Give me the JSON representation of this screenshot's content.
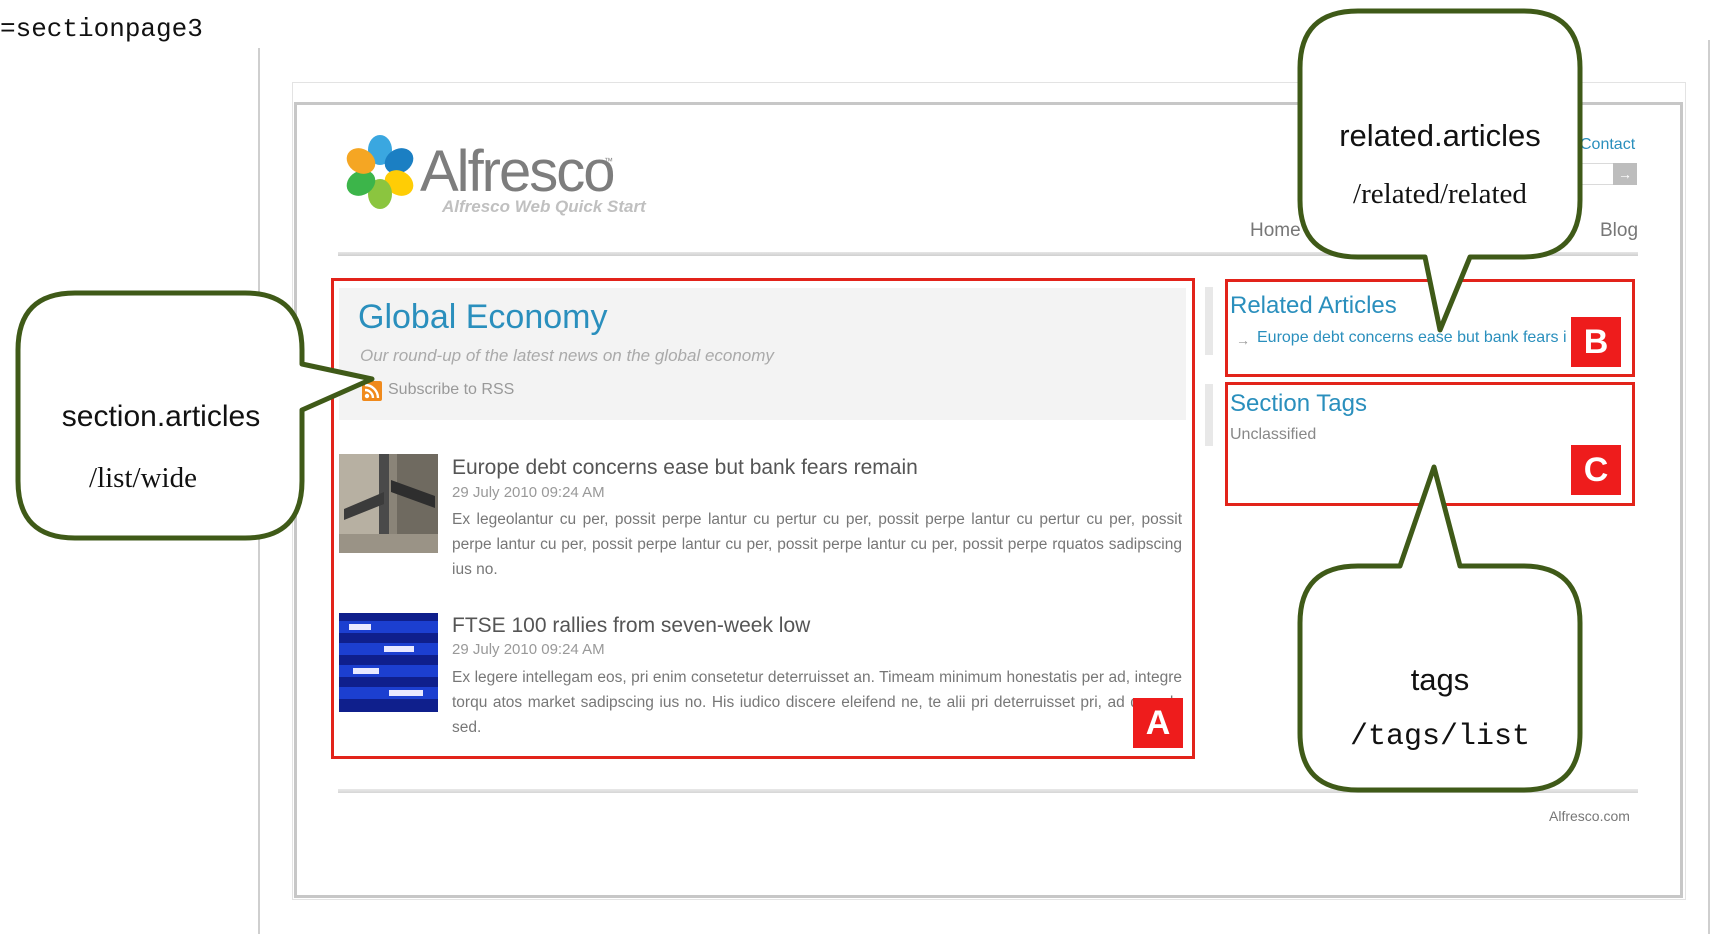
{
  "page_label": "=sectionpage3",
  "site": {
    "logo_text": "Alfresco",
    "logo_tm": "™",
    "logo_subtitle": "Alfresco Web Quick Start",
    "contact_link": "Contact",
    "search_button": "→",
    "nav": {
      "home": "Home",
      "blog": "Blog"
    },
    "footer_link": "Alfresco.com"
  },
  "section": {
    "title": "Global Economy",
    "description": "Our round-up of the latest news on the global economy",
    "rss_label": "Subscribe to RSS",
    "articles": [
      {
        "title": "Europe debt concerns ease but bank fears remain",
        "date": "29 July 2010 09:24 AM",
        "body": "Ex legeolantur cu per, possit perpe lantur cu pertur cu per, possit perpe lantur cu pertur cu per, possit perpe lantur cu per, possit perpe lantur cu per, possit perpe lantur cu per, possit perpe rquatos sadipscing ius no."
      },
      {
        "title": "FTSE 100 rallies from seven-week low",
        "date": "29 July 2010 09:24 AM",
        "body": "Ex legere intellegam eos, pri enim consetetur deterruisset an. Timeam minimum honestatis per ad, integre torqu atos market sadipscing ius no. His iudico discere eleifend ne, te alii pri deterruisset pri, ad quando sed."
      }
    ]
  },
  "related": {
    "title": "Related Articles",
    "arrow": "→",
    "item": "Europe debt concerns ease but bank fears i"
  },
  "tags": {
    "title": "Section Tags",
    "item": "Unclassified"
  },
  "regions": {
    "a": "A",
    "b": "B",
    "c": "C"
  },
  "callouts": {
    "section": {
      "name": "section.articles",
      "path": "/list/wide"
    },
    "related": {
      "name": "related.articles",
      "path": "/related/related"
    },
    "tags": {
      "name": "tags",
      "path": "/tags/list"
    }
  },
  "colors": {
    "link_blue": "#2a8fbd",
    "region_red": "#e2231a",
    "callout_stroke": "#3f5a18"
  }
}
